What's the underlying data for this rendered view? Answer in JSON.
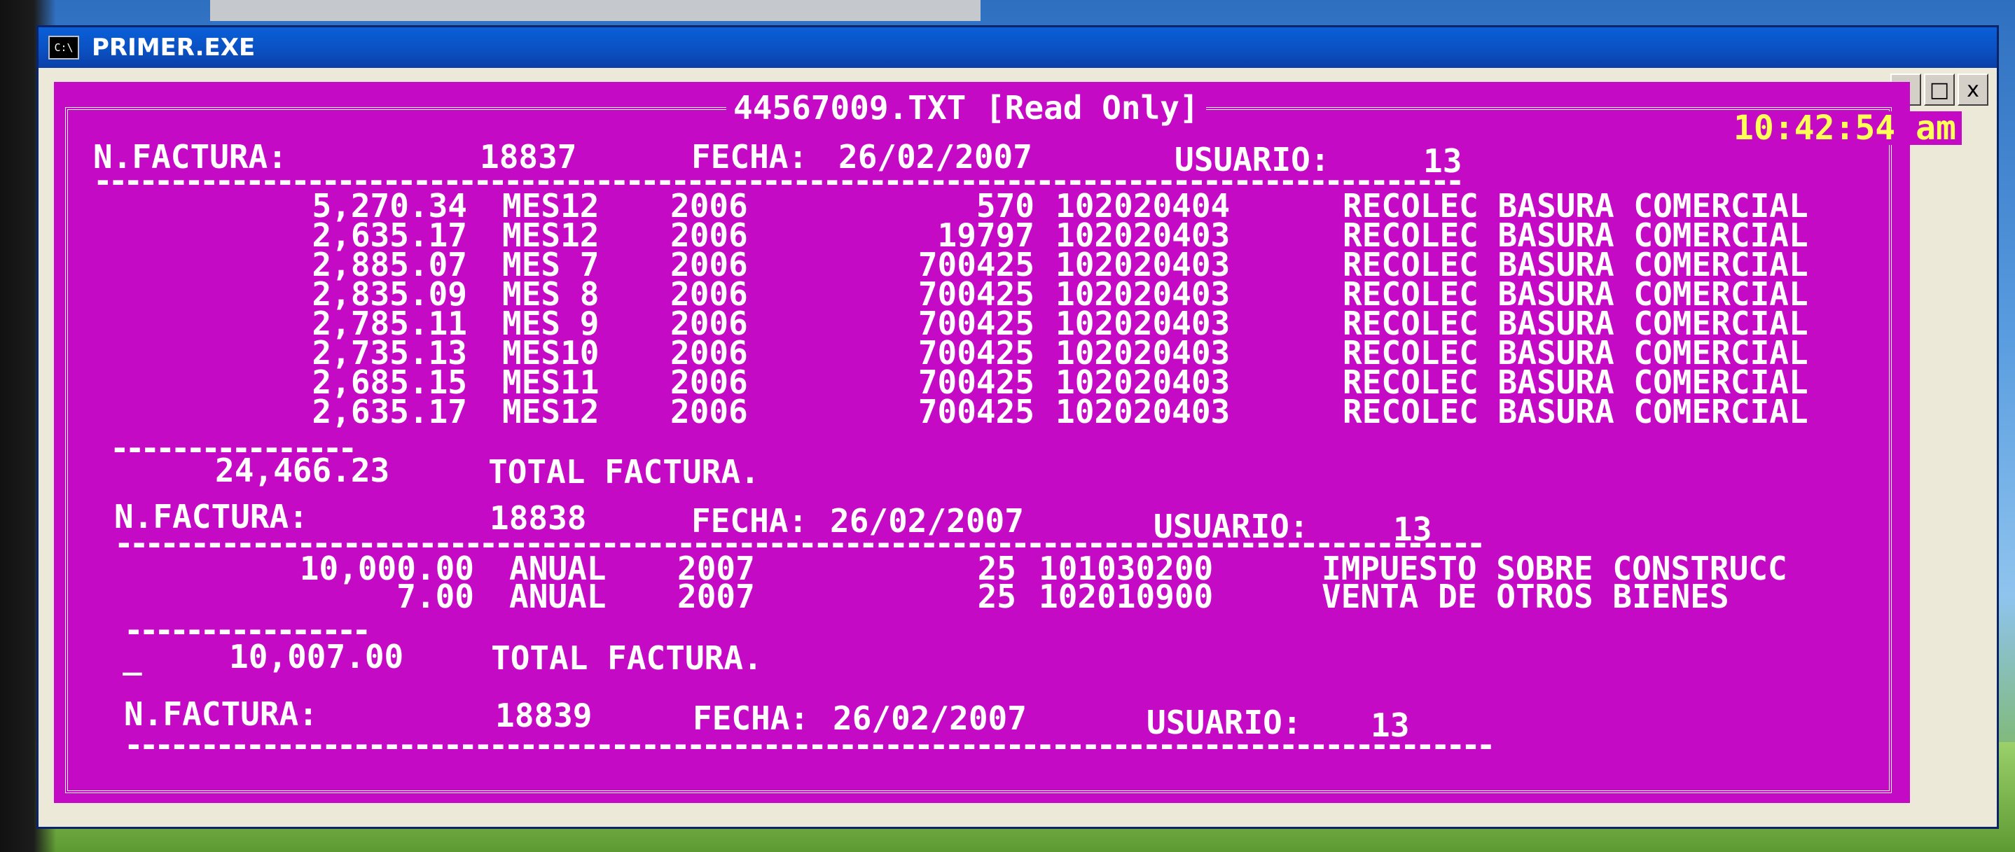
{
  "window": {
    "title": "PRIMER.EXE",
    "icon": "C:\\",
    "controls": [
      "-",
      "□",
      "x"
    ]
  },
  "console": {
    "frame_title": "44567009.TXT [Read Only]",
    "clock": "10:42:54 am",
    "colors": {
      "background": "#c40ac4",
      "text": "#ffffff",
      "clock": "#ffff55"
    },
    "invoices": [
      {
        "n_label": "N.FACTURA:",
        "number": "18837",
        "fecha_label": "FECHA:",
        "fecha": "26/02/2007",
        "usuario_label": "USUARIO:",
        "usuario": "13",
        "lines": [
          {
            "amount": "5,270.34",
            "period": "MES12",
            "year": "2006",
            "code": "570",
            "account": "102020404",
            "desc": "RECOLEC BASURA COMERCIAL"
          },
          {
            "amount": "2,635.17",
            "period": "MES12",
            "year": "2006",
            "code": "19797",
            "account": "102020403",
            "desc": "RECOLEC BASURA COMERCIAL"
          },
          {
            "amount": "2,885.07",
            "period": "MES 7",
            "year": "2006",
            "code": "700425",
            "account": "102020403",
            "desc": "RECOLEC BASURA COMERCIAL"
          },
          {
            "amount": "2,835.09",
            "period": "MES 8",
            "year": "2006",
            "code": "700425",
            "account": "102020403",
            "desc": "RECOLEC BASURA COMERCIAL"
          },
          {
            "amount": "2,785.11",
            "period": "MES 9",
            "year": "2006",
            "code": "700425",
            "account": "102020403",
            "desc": "RECOLEC BASURA COMERCIAL"
          },
          {
            "amount": "2,735.13",
            "period": "MES10",
            "year": "2006",
            "code": "700425",
            "account": "102020403",
            "desc": "RECOLEC BASURA COMERCIAL"
          },
          {
            "amount": "2,685.15",
            "period": "MES11",
            "year": "2006",
            "code": "700425",
            "account": "102020403",
            "desc": "RECOLEC BASURA COMERCIAL"
          },
          {
            "amount": "2,635.17",
            "period": "MES12",
            "year": "2006",
            "code": "700425",
            "account": "102020403",
            "desc": "RECOLEC BASURA COMERCIAL"
          }
        ],
        "total": "24,466.23",
        "total_label": "TOTAL FACTURA."
      },
      {
        "n_label": "N.FACTURA:",
        "number": "18838",
        "fecha_label": "FECHA:",
        "fecha": "26/02/2007",
        "usuario_label": "USUARIO:",
        "usuario": "13",
        "lines": [
          {
            "amount": "10,000.00",
            "period": "ANUAL",
            "year": "2007",
            "code": "25",
            "account": "101030200",
            "desc": "IMPUESTO SOBRE CONSTRUCC"
          },
          {
            "amount": "7.00",
            "period": "ANUAL",
            "year": "2007",
            "code": "25",
            "account": "102010900",
            "desc": "VENTA DE OTROS BIENES"
          }
        ],
        "total": "10,007.00",
        "total_label": "TOTAL FACTURA.",
        "total_prefix": "_"
      },
      {
        "n_label": "N.FACTURA:",
        "number": "18839",
        "fecha_label": "FECHA:",
        "fecha": "26/02/2007",
        "usuario_label": "USUARIO:",
        "usuario": "13"
      }
    ]
  }
}
